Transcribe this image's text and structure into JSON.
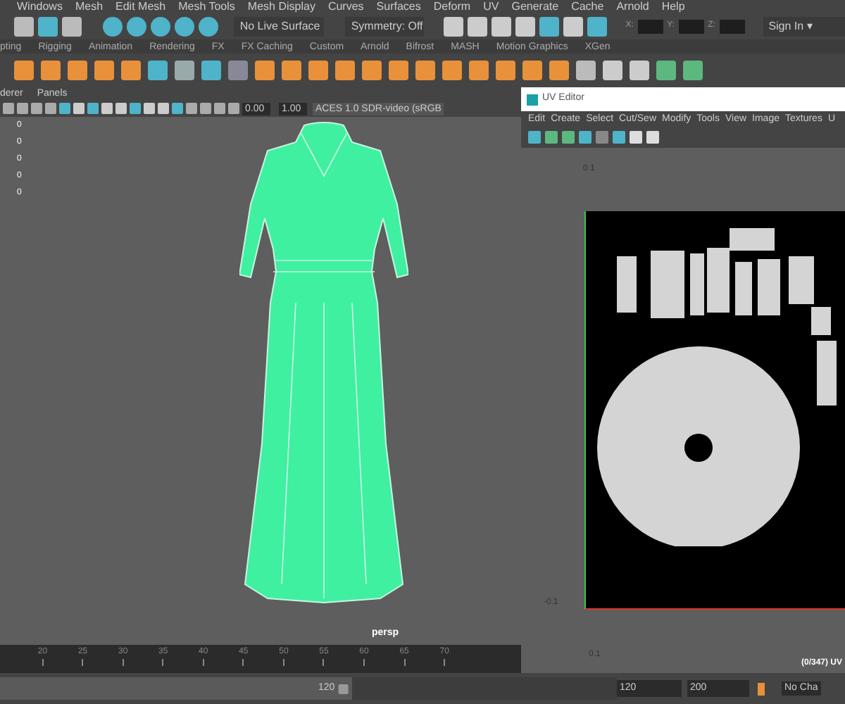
{
  "main_menu": [
    "Windows",
    "Mesh",
    "Edit Mesh",
    "Mesh Tools",
    "Mesh Display",
    "Curves",
    "Surfaces",
    "Deform",
    "UV",
    "Generate",
    "Cache",
    "Arnold",
    "Help"
  ],
  "status_line": {
    "live_surface": "No Live Surface",
    "symmetry": "Symmetry: Off",
    "coord_labels": [
      "X:",
      "Y:",
      "Z:"
    ],
    "sign_in": "Sign In",
    "sign_in_caret": "▾"
  },
  "shelf_tabs": [
    "pting",
    "Rigging",
    "Animation",
    "Rendering",
    "FX",
    "FX Caching",
    "Custom",
    "Arnold",
    "Bifrost",
    "MASH",
    "Motion Graphics",
    "XGen"
  ],
  "panel_menu": [
    "derer",
    "Panels"
  ],
  "viewport": {
    "exposure": "0.00",
    "gamma": "1.00",
    "color_space": "ACES 1.0 SDR-video (sRGB",
    "hud_values": [
      "0",
      "0",
      "0",
      "0",
      "0"
    ],
    "camera": "persp"
  },
  "uv_editor": {
    "title": "UV Editor",
    "menu": [
      "Edit",
      "Create",
      "Select",
      "Cut/Sew",
      "Modify",
      "Tools",
      "View",
      "Image",
      "Textures",
      "U"
    ],
    "axis_labels": [
      "0.1",
      "-0.1",
      "0.1"
    ],
    "uv_count": "(0/347) UV"
  },
  "time_slider": {
    "ticks": [
      "20",
      "25",
      "30",
      "35",
      "40",
      "45",
      "50",
      "55",
      "60",
      "65",
      "70"
    ]
  },
  "range_slider": {
    "level": 0.57,
    "current": "120",
    "end_field": "120",
    "max_field": "200",
    "character_set": "No Cha"
  }
}
